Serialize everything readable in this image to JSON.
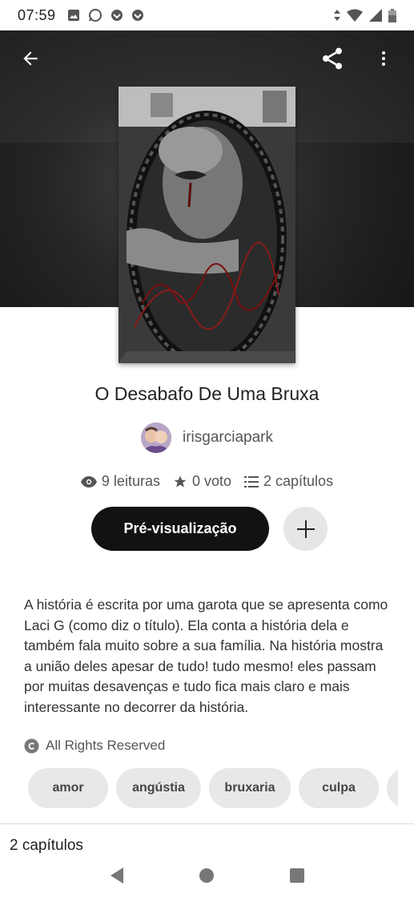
{
  "status_bar": {
    "time": "07:59"
  },
  "book": {
    "title": "O Desabafo De Uma Bruxa",
    "author": "irisgarciapark",
    "stats": {
      "reads": "9 leituras",
      "votes": "0 voto",
      "chapters": "2 capítulos"
    },
    "preview_label": "Pré-visualização",
    "description": "A história é escrita por uma garota que se apresenta como Laci G (como diz o título). Ela conta a história dela e também fala muito sobre a sua família. Na história mostra a união deles apesar de tudo! tudo mesmo! eles passam por muitas desavenças e tudo fica mais claro e mais interessante no decorrer da história.",
    "rights": "All Rights Reserved",
    "tags": [
      "amor",
      "angústia",
      "bruxaria",
      "culpa"
    ],
    "chapters_heading": "2 capítulos"
  },
  "icons": {
    "back": "arrow-left-icon",
    "share": "share-icon",
    "more": "more-vert-icon"
  },
  "colors": {
    "primary_button": "#121212",
    "secondary_button": "#e6e6e6",
    "tag_bg": "#e8e8e8"
  }
}
